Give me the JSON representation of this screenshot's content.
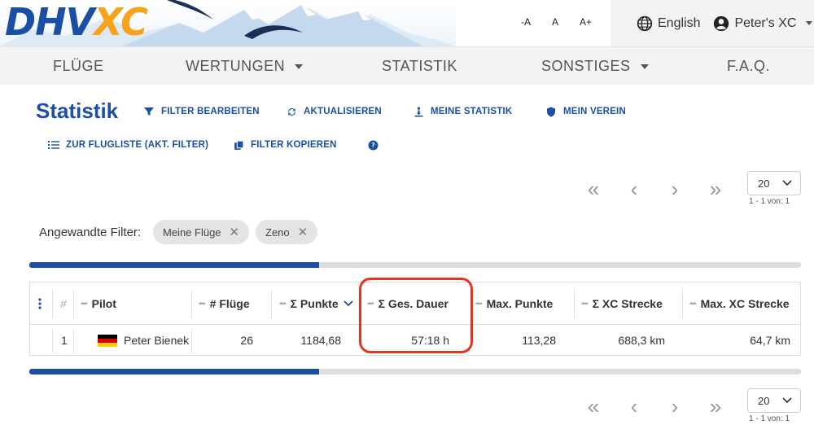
{
  "logo": {
    "part1": "DHV",
    "part2": "XC"
  },
  "font_controls": {
    "decrease": "-A",
    "normal": "A",
    "increase": "A+"
  },
  "header": {
    "language": "English",
    "account": "Peter's XC"
  },
  "nav": [
    {
      "label": "FLÜGE"
    },
    {
      "label": "WERTUNGEN"
    },
    {
      "label": "STATISTIK"
    },
    {
      "label": "SONSTIGES"
    },
    {
      "label": "F.A.Q."
    }
  ],
  "page": {
    "title": "Statistik"
  },
  "toolbar": {
    "edit_filter": "FILTER BEARBEITEN",
    "refresh": "AKTUALISIEREN",
    "my_stats": "MEINE STATISTIK",
    "my_club": "MEIN VEREIN",
    "to_flight_list": "ZUR FLUGLISTE (AKT. FILTER)",
    "copy_filter": "FILTER KOPIEREN"
  },
  "pagination": {
    "page_size": "20",
    "range": "1 - 1 von: 1"
  },
  "filters": {
    "label": "Angewandte Filter:",
    "chips": [
      "Meine Flüge",
      "Zeno"
    ]
  },
  "progress": {
    "top_fill_pct": 37.5,
    "bottom_fill_pct": 37.5
  },
  "table": {
    "headers": {
      "index": "#",
      "pilot": "Pilot",
      "flights": "# Flüge",
      "points": "Σ Punkte",
      "duration": "Σ Ges. Dauer",
      "max_points": "Max. Punkte",
      "xc_distance": "Σ XC Strecke",
      "max_xc_distance": "Max. XC Strecke"
    },
    "rows": [
      {
        "index": "1",
        "pilot": "Peter Bienek",
        "flights": "26",
        "points": "1184,68",
        "duration": "57:18 h",
        "max_points": "113,28",
        "xc_distance": "688,3 km",
        "max_xc_distance": "64,7 km"
      }
    ]
  },
  "colors": {
    "brand_blue": "#1a4fa3",
    "brand_orange": "#f7a21a",
    "highlight_red": "#e8321f"
  }
}
